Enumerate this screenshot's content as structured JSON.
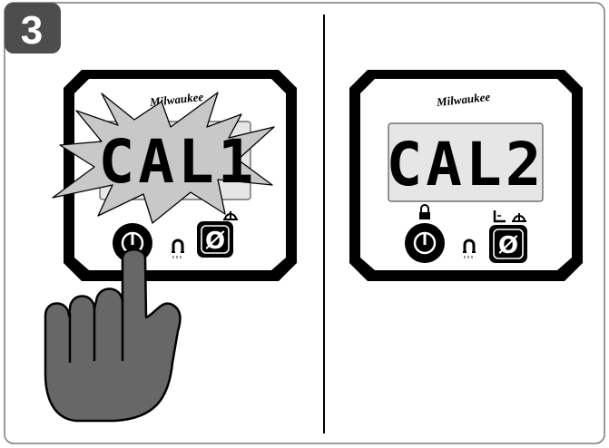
{
  "step": {
    "number": "3"
  },
  "left_device": {
    "brand": "Milwaukee",
    "display": "CAL1",
    "zero_button_glyph": "Ø"
  },
  "right_device": {
    "brand": "Milwaukee",
    "display": "CAL2",
    "zero_button_glyph": "Ø"
  },
  "icons": {
    "power": "power-icon",
    "magnet": "magnet-icon",
    "lock": "lock-icon",
    "level": "level-icon",
    "angle": "angle-icon",
    "hand": "hand-pointer-icon",
    "flash": "flash-burst-icon"
  },
  "colors": {
    "badge": "#4d4d4d",
    "hand": "#676767",
    "flash": "#c8c8c8",
    "lcd_bg": "#e6e6e6"
  }
}
